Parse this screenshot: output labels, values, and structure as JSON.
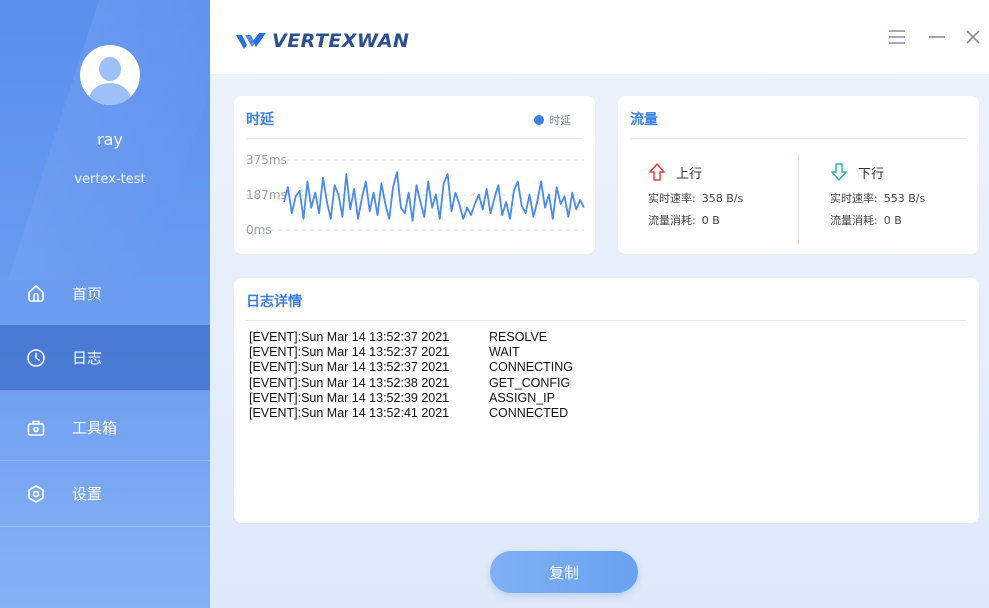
{
  "user": {
    "name": "ray",
    "org": "vertex-test"
  },
  "nav": [
    {
      "label": "首页",
      "icon": "home-icon"
    },
    {
      "label": "日志",
      "icon": "clock-icon",
      "active": true
    },
    {
      "label": "工具箱",
      "icon": "toolbox-icon"
    },
    {
      "label": "设置",
      "icon": "settings-icon"
    }
  ],
  "header": {
    "brand": "VERTEXWAN"
  },
  "latency": {
    "title": "时延",
    "legend": "时延",
    "y_ticks": [
      "375ms",
      "187ms",
      "0ms"
    ],
    "accent": "#3d7fe6"
  },
  "chart_data": {
    "type": "line",
    "title": "时延",
    "ylim": [
      0,
      375
    ],
    "series": [
      {
        "name": "时延",
        "values": [
          150,
          230,
          90,
          180,
          210,
          60,
          260,
          120,
          200,
          90,
          280,
          150,
          60,
          240,
          190,
          70,
          300,
          110,
          220,
          60,
          170,
          260,
          100,
          200,
          80,
          250,
          140,
          60,
          230,
          310,
          120,
          90,
          200,
          50,
          240,
          150,
          70,
          260,
          120,
          190,
          60,
          250,
          300,
          100,
          200,
          140,
          60,
          120,
          80,
          140,
          190,
          110,
          220,
          90,
          170,
          240,
          80,
          150,
          60,
          210,
          260,
          130,
          90,
          190,
          70,
          150,
          260,
          120,
          190,
          60,
          230,
          140,
          180,
          70,
          200,
          110,
          160,
          120
        ]
      }
    ]
  },
  "traffic": {
    "title": "流量",
    "upload": {
      "label": "上行",
      "rate_label": "实时速率:",
      "rate": "358 B/s",
      "usage_label": "流量消耗:",
      "usage": "0 B"
    },
    "download": {
      "label": "下行",
      "rate_label": "实时速率:",
      "rate": "553 B/s",
      "usage_label": "流量消耗:",
      "usage": "0 B"
    },
    "up_color": "#e8433a",
    "down_color": "#2fb99a"
  },
  "log": {
    "title": "日志详情",
    "entries": [
      {
        "event": "[EVENT]:Sun Mar 14 13:52:37 2021",
        "status": "RESOLVE"
      },
      {
        "event": "[EVENT]:Sun Mar 14 13:52:37 2021",
        "status": "WAIT"
      },
      {
        "event": "[EVENT]:Sun Mar 14 13:52:37 2021",
        "status": "CONNECTING"
      },
      {
        "event": "[EVENT]:Sun Mar 14 13:52:38 2021",
        "status": "GET_CONFIG"
      },
      {
        "event": "[EVENT]:Sun Mar 14 13:52:39 2021",
        "status": "ASSIGN_IP"
      },
      {
        "event": "[EVENT]:Sun Mar 14 13:52:41 2021",
        "status": "CONNECTED"
      }
    ]
  },
  "actions": {
    "copy": "复制"
  }
}
